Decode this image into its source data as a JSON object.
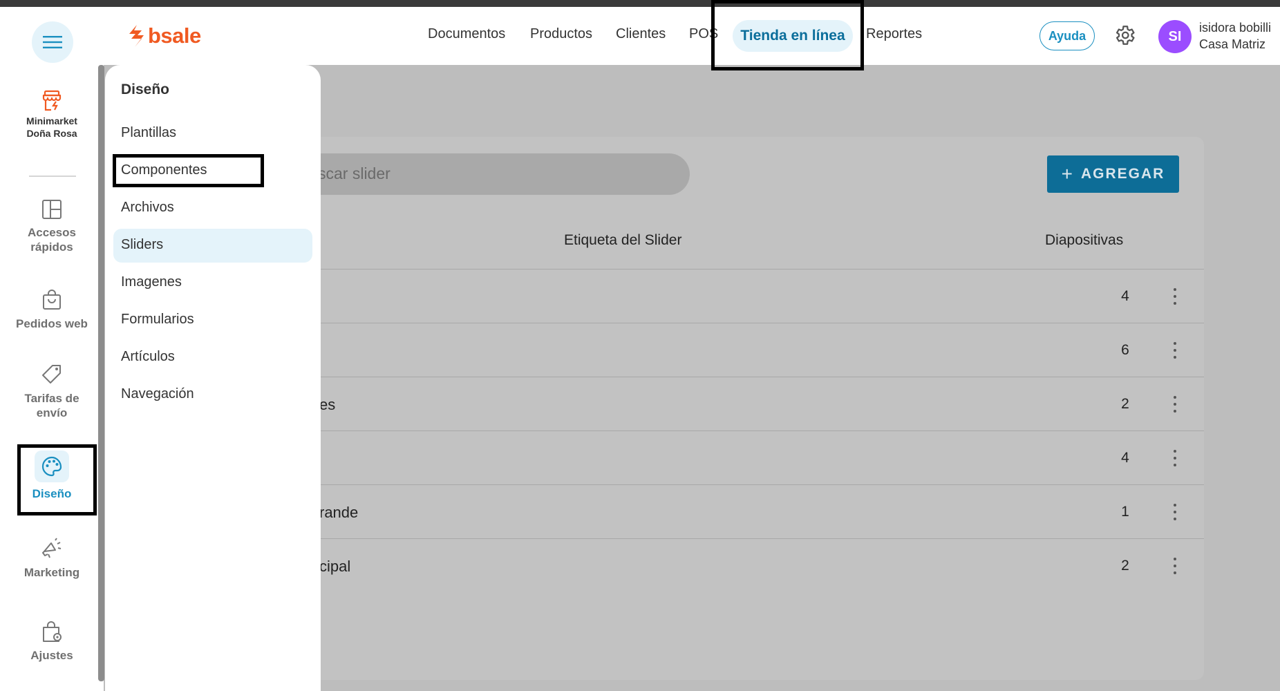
{
  "header": {
    "logo_text": "bsale",
    "nav": [
      "Documentos",
      "Productos",
      "Clientes",
      "POS"
    ],
    "nav_active": "Tienda en línea",
    "nav_after": "Reportes",
    "help_label": "Ayuda",
    "avatar_initials": "SI",
    "user_name": "isidora bobilli",
    "branch": "Casa Matriz"
  },
  "sidebar": {
    "store_line1": "Minimarket",
    "store_line2": "Doña Rosa",
    "items": [
      {
        "line1": "Accesos",
        "line2": "rápidos",
        "icon": "layout-icon"
      },
      {
        "line1": "Pedidos web",
        "line2": "",
        "icon": "shopping-bag-icon"
      },
      {
        "line1": "Tarifas de",
        "line2": "envío",
        "icon": "tag-icon"
      },
      {
        "line1": "Diseño",
        "line2": "",
        "icon": "palette-icon"
      },
      {
        "line1": "Marketing",
        "line2": "",
        "icon": "megaphone-icon"
      },
      {
        "line1": "Ajustes",
        "line2": "",
        "icon": "settings-bag-icon"
      }
    ]
  },
  "submenu": {
    "title": "Diseño",
    "items": [
      "Plantillas",
      "Componentes",
      "Archivos",
      "Sliders",
      "Imagenes",
      "Formularios",
      "Artículos",
      "Navegación"
    ],
    "active": "Sliders"
  },
  "main": {
    "search_placeholder_visible": "scar slider",
    "add_button": "AGREGAR",
    "columns": {
      "label": "Etiqueta del Slider",
      "slides": "Diapositivas"
    },
    "rows": [
      {
        "label": "",
        "slides": "4"
      },
      {
        "label": "",
        "slides": "6"
      },
      {
        "label": "es",
        "slides": "2"
      },
      {
        "label": "",
        "slides": "4"
      },
      {
        "label": "rande",
        "slides": "1"
      },
      {
        "label": "cipal",
        "slides": "2"
      }
    ]
  },
  "colors": {
    "brand": "#f05a22",
    "accent": "#0a6e9b",
    "active_bg": "#e4f3fa",
    "avatar": "#9b4dff",
    "add_button": "#0d6d97"
  }
}
